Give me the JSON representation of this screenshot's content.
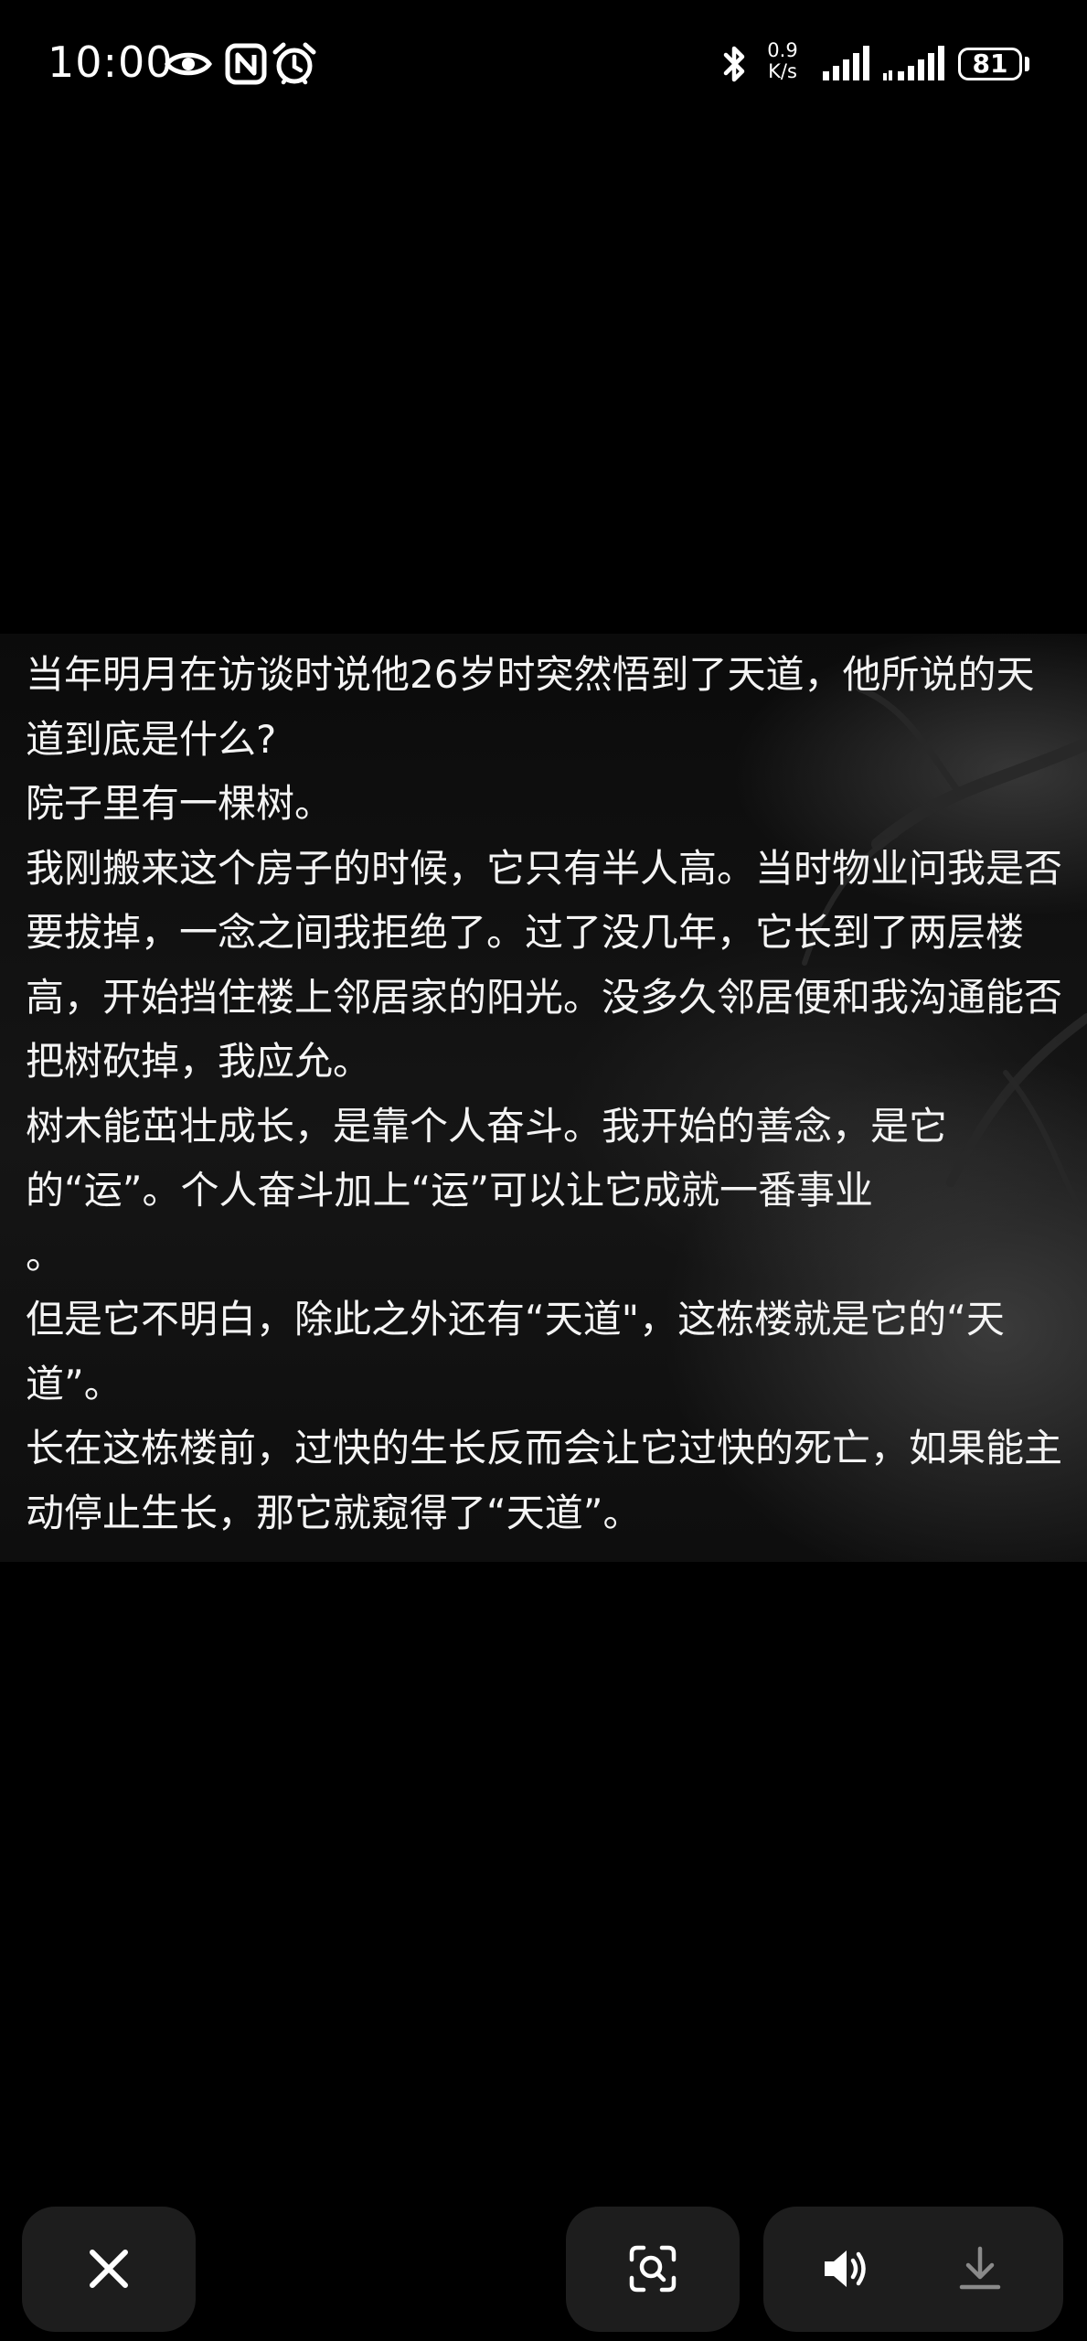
{
  "status_bar": {
    "time": "10:00",
    "network_speed_value": "0.9",
    "network_speed_unit": "K/s",
    "battery_level": "81",
    "icons": [
      "eye-icon",
      "nfc-icon",
      "alarm-icon",
      "bluetooth-icon",
      "signal-icon",
      "signal-2-icon"
    ]
  },
  "content": {
    "paragraphs": [
      "当年明月在访谈时说他26岁时突然悟到了天道，他所说的天道到底是什么?",
      "院子里有一棵树。",
      "我刚搬来这个房子的时候，它只有半人高。当时物业问我是否要拔掉，一念之间我拒绝了。过了没几年，它长到了两层楼高，开始挡住楼上邻居家的阳光。没多久邻居便和我沟通能否把树砍掉，我应允。",
      "树木能茁壮成长，是靠个人奋斗。我开始的善念，是它的“运”。个人奋斗加上“运”可以让它成就一番事业\n。",
      "但是它不明白，除此之外还有“天道\"，这栋楼就是它的“天道”。",
      "长在这栋楼前，过快的生长反而会让它过快的死亡，如果能主动停止生长，那它就窥得了“天道”。"
    ]
  },
  "toolbar": {
    "icons": [
      "close-icon",
      "lens-search-icon",
      "speaker-icon",
      "download-icon"
    ]
  },
  "colors": {
    "background": "#000000",
    "toolbar_button": "#1d1d1d",
    "text": "#f4f4f4",
    "download_icon": "#8a8a8a"
  }
}
